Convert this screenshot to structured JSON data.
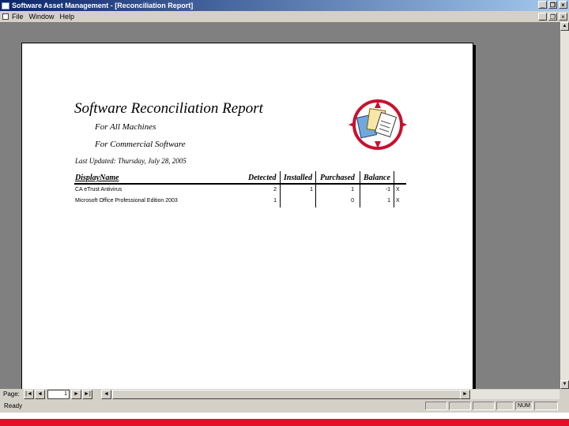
{
  "window": {
    "title": "Software Asset Management - [Reconciliation Report]"
  },
  "menu": {
    "items": [
      "File",
      "Window",
      "Help"
    ]
  },
  "controls": {
    "minimize": "_",
    "restore": "❐",
    "close": "×"
  },
  "report": {
    "title": "Software Reconciliation Report",
    "subtitle1": "For All Machines",
    "subtitle2": "For Commercial Software",
    "last_updated": "Last Updated: Thursday, July 28, 2005",
    "columns": [
      "DisplayName",
      "Detected",
      "Installed",
      "Purchased",
      "Balance"
    ],
    "rows": [
      {
        "name": "CA eTrust Antivirus",
        "detected": "2",
        "installed": "1",
        "purchased": "1",
        "balance": "-1",
        "flag": "X"
      },
      {
        "name": "Microsoft Office Professional Edition 2003",
        "detected": "1",
        "installed": "",
        "purchased": "0",
        "balance": "1",
        "flag": "X"
      }
    ],
    "logo_icon": "report-clipart-icon"
  },
  "navigation": {
    "page_label": "Page:",
    "page_value": "1",
    "first": "|◄",
    "prev": "◄",
    "next": "►",
    "last": "►|"
  },
  "status": {
    "text": "Ready",
    "num": "NUM"
  },
  "colors": {
    "title_dark": "#0a246a",
    "title_light": "#a6caf0",
    "chrome": "#d4d0c8",
    "workspace": "#808080",
    "accent": "#e0102a"
  }
}
